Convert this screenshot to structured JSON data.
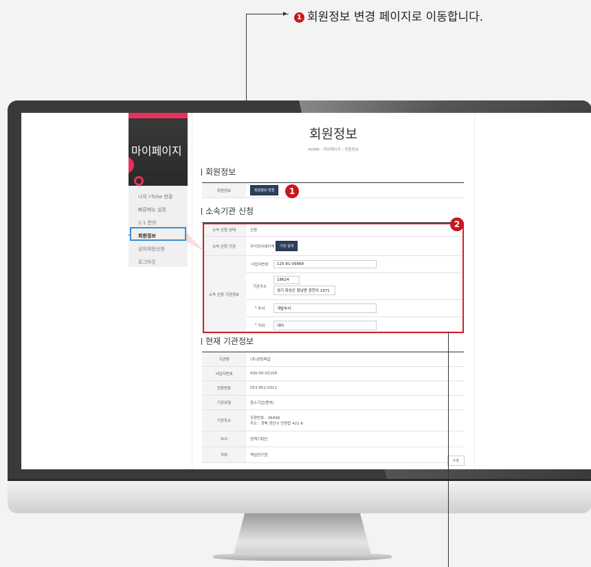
{
  "caption": {
    "number": "1",
    "text": "회원정보 변경 페이지로 이동합니다."
  },
  "sidebar": {
    "title": "마이페이지",
    "items": [
      {
        "label": "나의 i-Tube 현황"
      },
      {
        "label": "빠른메뉴 설정"
      },
      {
        "label": "1:1 문의"
      },
      {
        "label": "회원정보"
      },
      {
        "label": "심의위원신청"
      },
      {
        "label": "로그아웃"
      }
    ]
  },
  "page": {
    "title": "회원정보",
    "breadcrumb": "HOME  ›  마이페이지  ›  회원정보"
  },
  "member": {
    "section_title": "회원정보",
    "row_label": "회원정보",
    "button": "회원정보 변경"
  },
  "affiliation": {
    "section_title": "소속기관 신청",
    "status_label": "소속 신청 상태",
    "status_value": "신청",
    "org_label": "소속 신청 기관",
    "org_value": "주식회사에이엑",
    "org_button": "기관 검색",
    "info_label": "소속 신청 기관정보",
    "biz_label": "사업자번호",
    "biz_value": "125-81-09968",
    "addr_label": "기관주소",
    "addr_zip": "18624",
    "addr_value": "경기 화성군 향남면 광천리 1971",
    "dept_label": "부서",
    "dept_value": "개발부서",
    "pos_label": "직위",
    "pos_value": "대리",
    "required_mark": "*"
  },
  "current": {
    "section_title": "현재 기관정보",
    "rows": [
      {
        "label": "기관명",
        "value": "(주)성림목업"
      },
      {
        "label": "사업자번호",
        "value": "000-00-02158"
      },
      {
        "label": "전화번호",
        "value": "053-851-0311"
      },
      {
        "label": "기관유형",
        "value": "중소기업(벤처)"
      },
      {
        "label": "기관주소",
        "value": "우편번호 : 38498",
        "value2": "주소 : 경북 경산시 진량읍 421-6"
      },
      {
        "label": "부서",
        "value": "정책기획단"
      },
      {
        "label": "직위",
        "value": "책임연구원"
      }
    ],
    "edit_button": "수정"
  },
  "badges": {
    "one": "1",
    "two": "2"
  }
}
